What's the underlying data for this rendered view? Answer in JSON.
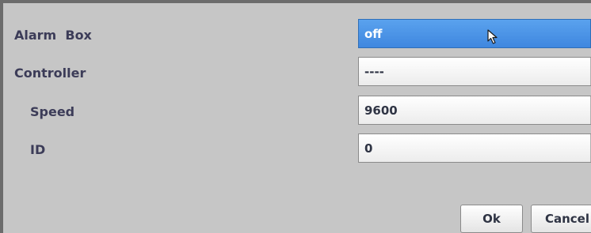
{
  "settings": {
    "alarm_box": {
      "label": "Alarm  Box",
      "value": "off"
    },
    "controller": {
      "label": "Controller",
      "value": "----"
    },
    "speed": {
      "label": "Speed",
      "value": "9600"
    },
    "id": {
      "label": "ID",
      "value": "0"
    }
  },
  "buttons": {
    "ok_label": "Ok",
    "cancel_label": "Cancel"
  },
  "colors": {
    "panel_bg": "#c6c6c6",
    "active_select": "#4a93e6",
    "label_text": "#3c3c58"
  },
  "icons": {
    "cursor": "mouse-pointer-icon",
    "dropdown": "chevron-down-icon"
  }
}
